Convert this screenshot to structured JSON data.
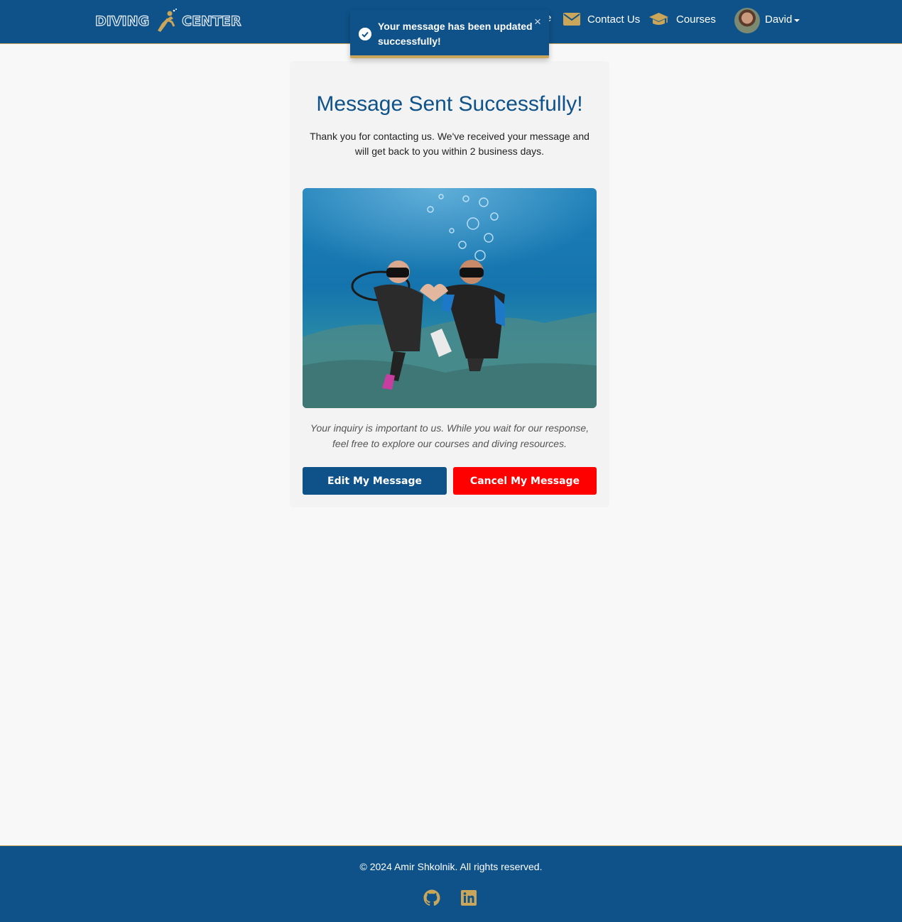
{
  "brand": {
    "logo_left": "DIVING",
    "logo_right": "CENTER"
  },
  "nav": {
    "partial_label": "e",
    "contact_label": "Contact Us",
    "courses_label": "Courses",
    "user_name": "David"
  },
  "toast": {
    "message": "Your message has been updated successfully!",
    "close": "×"
  },
  "card": {
    "title": "Message Sent Successfully!",
    "body": "Thank you for contacting us. We've received your message and will get back to you within 2 business days.",
    "note": "Your inquiry is important to us. While you wait for our response, feel free to explore our courses and diving resources.",
    "edit_label": "Edit My Message",
    "cancel_label": "Cancel My Message"
  },
  "footer": {
    "copyright": "© 2024 Amir Shkolnik. All rights reserved."
  },
  "colors": {
    "primary": "#0e5289",
    "accent": "#c9a65a",
    "danger": "#ff0000"
  },
  "icons": [
    "envelope-icon",
    "graduation-cap-icon",
    "github-icon",
    "linkedin-icon",
    "check-circle-icon"
  ]
}
